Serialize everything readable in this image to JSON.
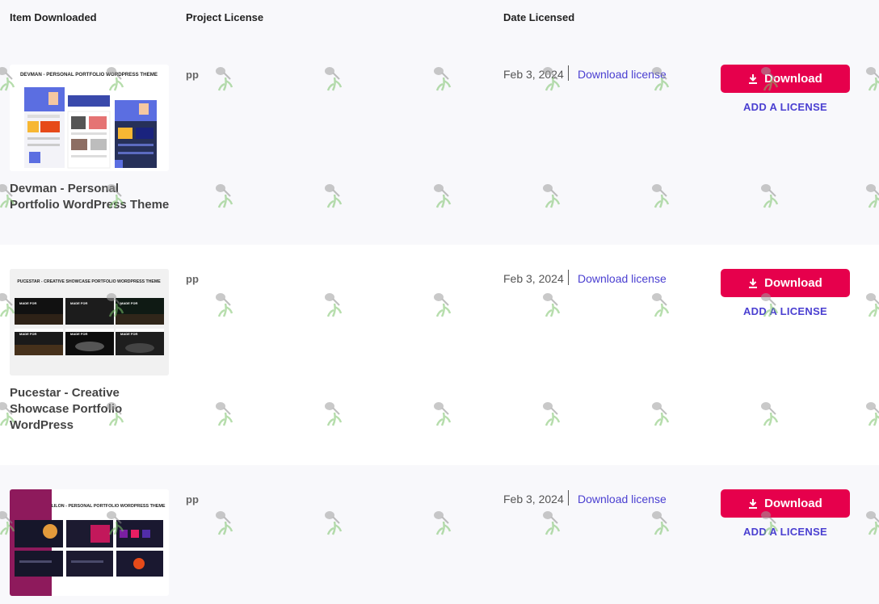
{
  "table": {
    "headers": {
      "item": "Item Downloaded",
      "license": "Project License",
      "date": "Date Licensed"
    },
    "rows": [
      {
        "thumb_title": "DEVMAN - PERSONAL PORTFOLIO WORDPRESS THEME",
        "name": "Devman - Personal Portfolio WordPress Theme",
        "license": "pp",
        "date": "Feb 3, 2024",
        "download_license": "Download license",
        "download": "Download",
        "add_license": "ADD A LICENSE"
      },
      {
        "thumb_title": "PUCESTAR - CREATIVE SHOWCASE PORTFOLIO WORDPRESS THEME",
        "name": "Pucestar - Creative Showcase Portfolio WordPress",
        "license": "pp",
        "date": "Feb 3, 2024",
        "download_license": "Download license",
        "download": "Download",
        "add_license": "ADD A LICENSE",
        "tile_label": "MADE FOR"
      },
      {
        "thumb_title": "LILON - PERSONAL PORTFOLIO WORDPRESS THEME",
        "license": "pp",
        "date": "Feb 3, 2024",
        "download_license": "Download license",
        "download": "Download",
        "add_license": "ADD A LICENSE"
      }
    ]
  },
  "colors": {
    "accent": "#e6004c",
    "link": "#4a3fd1",
    "row_alt": "#ffffff",
    "background": "#f8f8fb"
  },
  "icons": {
    "download": "download-arrow-icon",
    "watermark": "watering-can-watermark-icon"
  }
}
